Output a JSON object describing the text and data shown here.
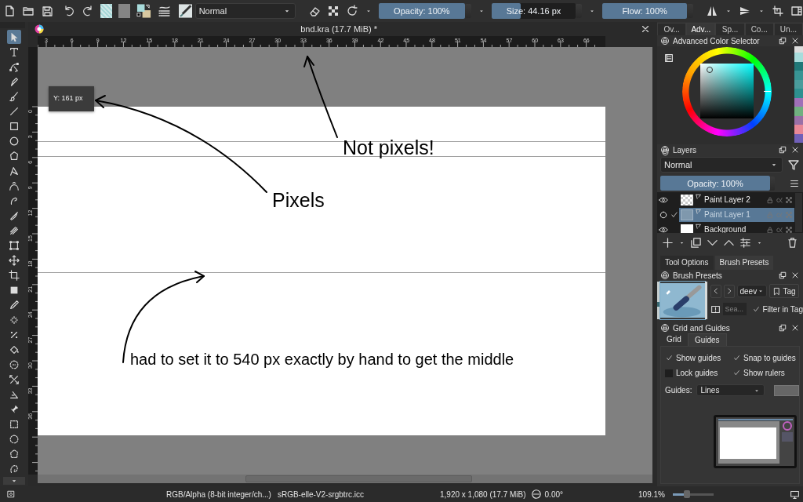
{
  "toolbar": {
    "blend_mode": "Normal",
    "opacity": {
      "label": "Opacity: 100%",
      "level": 1
    },
    "size": {
      "label": "Size: 44.16 px",
      "level": 0.35
    },
    "flow": {
      "label": "Flow: 100%",
      "level": 1
    }
  },
  "document_tab": {
    "title": "bnd.kra (17.7 MiB) *"
  },
  "docker_tabs": [
    {
      "label": "Ov...",
      "selected": false
    },
    {
      "label": "Adv...",
      "selected": true
    },
    {
      "label": "Sp...",
      "selected": false
    },
    {
      "label": "Co...",
      "selected": false
    },
    {
      "label": "Un...",
      "selected": false
    }
  ],
  "tools": [
    {
      "kind": "pointer",
      "selected": true
    },
    {
      "kind": "text",
      "selected": false
    },
    {
      "kind": "shape-edit",
      "selected": false
    },
    {
      "kind": "calligraphy",
      "selected": false
    },
    {
      "kind": "brush",
      "selected": false
    },
    {
      "kind": "line",
      "selected": false
    },
    {
      "kind": "rect",
      "selected": false
    },
    {
      "kind": "ellipse",
      "selected": false
    },
    {
      "kind": "polygon",
      "selected": false
    },
    {
      "kind": "polyline",
      "selected": false
    },
    {
      "kind": "bezier",
      "selected": false
    },
    {
      "kind": "freehand-path",
      "selected": false
    },
    {
      "kind": "dynamic-brush",
      "selected": false
    },
    {
      "kind": "multibrush",
      "selected": false
    },
    {
      "kind": "transform",
      "selected": false
    },
    {
      "kind": "move",
      "selected": false
    },
    {
      "kind": "crop",
      "selected": false
    },
    {
      "kind": "gradient",
      "selected": false
    },
    {
      "kind": "color-picker",
      "selected": false
    },
    {
      "kind": "smart-patch",
      "selected": false
    },
    {
      "kind": "assistant",
      "selected": false
    },
    {
      "kind": "fill",
      "selected": false
    },
    {
      "kind": "colorize",
      "selected": false
    },
    {
      "kind": "measure",
      "selected": false
    },
    {
      "kind": "angle",
      "selected": false
    },
    {
      "kind": "reference",
      "selected": false
    },
    {
      "kind": "rect-select",
      "selected": false
    },
    {
      "kind": "ellipse-select",
      "selected": false
    },
    {
      "kind": "polygon-select",
      "selected": false
    },
    {
      "kind": "freehand-select",
      "selected": false
    }
  ],
  "rulers": {
    "horizontal": [
      "3",
      "6",
      "9",
      "12",
      "15",
      "18",
      "21",
      "24",
      "27",
      "30",
      "33",
      "36",
      "39",
      "42",
      "45",
      "48",
      "51",
      "54",
      "57",
      "60",
      "63",
      "66"
    ],
    "vertical": [
      "0",
      "3",
      "6",
      "9",
      "12",
      "15",
      "18",
      "21",
      "24",
      "27",
      "30",
      "33",
      "36"
    ]
  },
  "canvas": {
    "tooltip": "Y: 161 px",
    "annotations": [
      "Not pixels!",
      "Pixels",
      "had to set it to 540 px exactly by hand to get the middle"
    ]
  },
  "color_selector": {
    "title": "Advanced Color Selector",
    "swatches": [
      {
        "color": "#a8dcdc"
      },
      {
        "color": "#207878"
      },
      {
        "color": "#389494"
      },
      {
        "color": "#4a9c9c"
      },
      {
        "color": "#2e9090"
      },
      {
        "color": "#a070b8"
      },
      {
        "color": "#70b080"
      },
      {
        "color": "#9a70a8"
      },
      {
        "color": "#e88898"
      },
      {
        "color": "#7060b8"
      }
    ]
  },
  "layers": {
    "title": "Layers",
    "blend_mode": "Normal",
    "opacity": {
      "label": "Opacity:  100%",
      "level": 1
    },
    "items": [
      {
        "name": "Paint Layer 2",
        "visible": true,
        "selected": false,
        "kind": "transparent"
      },
      {
        "name": "Paint Layer 1",
        "visible": false,
        "selected": true,
        "kind": "transparent"
      },
      {
        "name": "Background",
        "visible": true,
        "selected": false,
        "kind": "white"
      }
    ]
  },
  "lower_tabs": [
    {
      "label": "Tool Options",
      "selected": false
    },
    {
      "label": "Brush Presets",
      "selected": true
    }
  ],
  "brush_presets": {
    "title": "Brush Presets",
    "tag": "deev",
    "tag_button": "Tag",
    "search_placeholder": "Sea...",
    "filter_in_tag": {
      "label": "Filter in Tag",
      "checked": true
    }
  },
  "grid_guides": {
    "title": "Grid and Guides",
    "tabs": [
      {
        "label": "Grid",
        "selected": false
      },
      {
        "label": "Guides",
        "selected": true
      }
    ],
    "options": [
      {
        "label": "Show guides",
        "checked": true
      },
      {
        "label": "Snap to guides",
        "checked": true
      },
      {
        "label": "Lock guides",
        "checked": false
      },
      {
        "label": "Show rulers",
        "checked": true
      }
    ],
    "guides_label": "Guides:",
    "guides_type": "Lines"
  },
  "status_bar": {
    "color_space": "RGB/Alpha (8-bit integer/ch...)",
    "profile": "sRGB-elle-V2-srgbtrc.icc",
    "dimensions": "1,920 x 1,080 (17.7 MiB)",
    "rotation": "0.00°",
    "zoom": "109.1%",
    "zoom_slider": {
      "level": 0.35
    }
  }
}
